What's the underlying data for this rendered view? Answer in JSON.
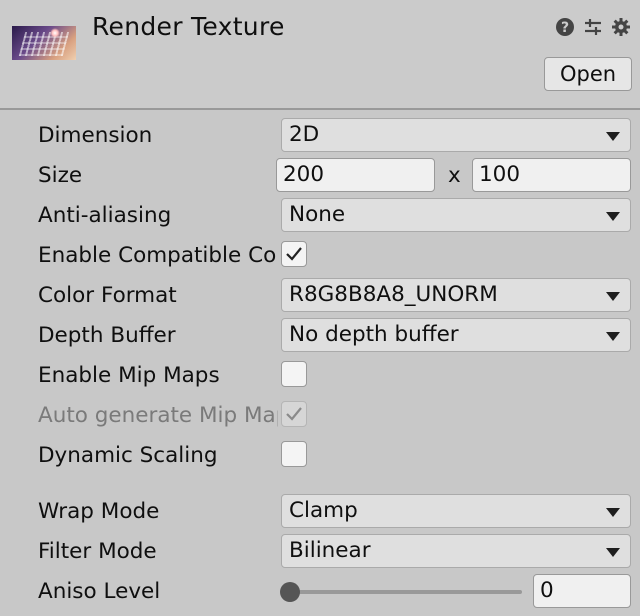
{
  "header": {
    "title": "Render Texture",
    "open_label": "Open",
    "icons": [
      "help-icon",
      "presets-icon",
      "gear-icon"
    ]
  },
  "fields": {
    "dimension": {
      "label": "Dimension",
      "value": "2D"
    },
    "size": {
      "label": "Size",
      "width": "200",
      "separator": "x",
      "height": "100"
    },
    "anti_aliasing": {
      "label": "Anti-aliasing",
      "value": "None"
    },
    "enable_compatible": {
      "label": "Enable Compatible Color Format",
      "checked": true
    },
    "color_format": {
      "label": "Color Format",
      "value": "R8G8B8A8_UNORM"
    },
    "depth_buffer": {
      "label": "Depth Buffer",
      "value": "No depth buffer"
    },
    "enable_mip_maps": {
      "label": "Enable Mip Maps",
      "checked": false
    },
    "auto_generate_mip_maps": {
      "label": "Auto generate Mip Maps",
      "checked": true,
      "disabled": true
    },
    "dynamic_scaling": {
      "label": "Dynamic Scaling",
      "checked": false
    },
    "wrap_mode": {
      "label": "Wrap Mode",
      "value": "Clamp"
    },
    "filter_mode": {
      "label": "Filter Mode",
      "value": "Bilinear"
    },
    "aniso_level": {
      "label": "Aniso Level",
      "value": "0",
      "slider_fraction": 0
    }
  },
  "colors": {
    "panel_bg": "#c8c8c8",
    "text": "#0f0f0f",
    "disabled_text": "#7a7a7a"
  }
}
